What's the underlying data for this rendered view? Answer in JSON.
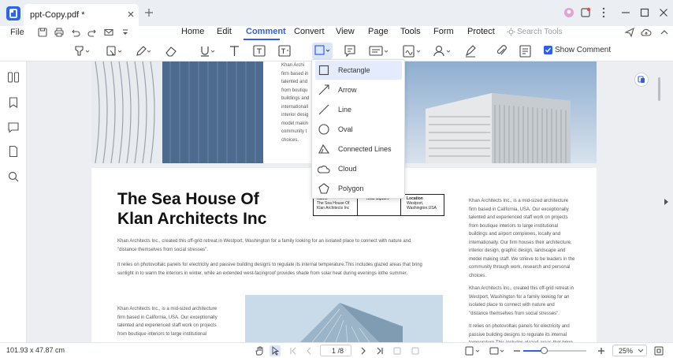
{
  "tab": {
    "title": "ppt-Copy.pdf *"
  },
  "menu": {
    "file": "File",
    "items": [
      "Home",
      "Edit",
      "Comment",
      "Convert",
      "View",
      "Page",
      "Tools",
      "Form",
      "Protect"
    ],
    "search_placeholder": "Search Tools"
  },
  "toolbar": {
    "show_comment": "Show Comment"
  },
  "shape_menu": {
    "items": [
      "Rectangle",
      "Arrow",
      "Line",
      "Oval",
      "Connected Lines",
      "Cloud",
      "Polygon"
    ],
    "selected": "Rectangle"
  },
  "document": {
    "page1_snippet": [
      "Khan Archi",
      "firm based in",
      "talented and",
      "from boutiqu",
      "buildings and",
      "internationall",
      "interior desig",
      "model makin",
      "community t",
      "choices."
    ],
    "heading_line1": "The Sea House Of",
    "heading_line2": "Klan Architects Inc",
    "para1": [
      "Khan Architects Inc., created this off-grid retreat in Westport, Washington for a family looking for an isolated place to connect with nature and",
      "\"distance themselves from social stresses\"."
    ],
    "para2": [
      "It relies on photovoltaic panels for electricity and passive building designs to regulate its internal temperature.This includes glazed areas that bring",
      "sunlight in to warm the interiors in winter, while an extended west-facingroof provides shade from solar heat during evenings inthe summer."
    ],
    "para3": [
      "Khan Architects Inc., is a mid-sized architecture",
      "firm based in California, USA. Our exceptionally",
      "talented and experienced staff work on projects",
      "from boutique interiors to large institutional"
    ],
    "table": {
      "col1_head": "Name",
      "col1_val": [
        "The Sea House Of",
        "Klan Architects Inc"
      ],
      "col2_head": "Total Square",
      "col3_head": "Location",
      "col3_val": [
        "Westport,",
        "Washington,USA"
      ]
    },
    "right_col": [
      "Khan Architects Inc., is a mid-sized architecture",
      "firm based in California, USA. Our exceptionally",
      "talented and experienced staff work on projects",
      "from boutique interiors to large institutional",
      "buildings and airport complexes, locally and",
      "internationally. Our firm houses their architecture,",
      "interior design, graphic design, landscape and",
      "model making staff. We strieve to be leaders in the",
      "community through work, research and personal",
      "choices.",
      "",
      "Khan Architects Inc., created this off-grid retreat in",
      "Westport, Washington for a family looking for an",
      "isolated place to connect with nature and",
      "\"distance themselves from social stresses\".",
      "",
      "It relies on photovoltaic panels for electricity and",
      "passive building designs to regulate its internal",
      "temperature.This includes glazed areas that bring"
    ]
  },
  "status": {
    "dimensions": "101.93 x 47.87 cm",
    "page": "1 /8",
    "zoom": "25%",
    "zoom_level": 0.33
  },
  "colors": {
    "accent": "#2f5ee8",
    "brand": "#2e64e8"
  }
}
